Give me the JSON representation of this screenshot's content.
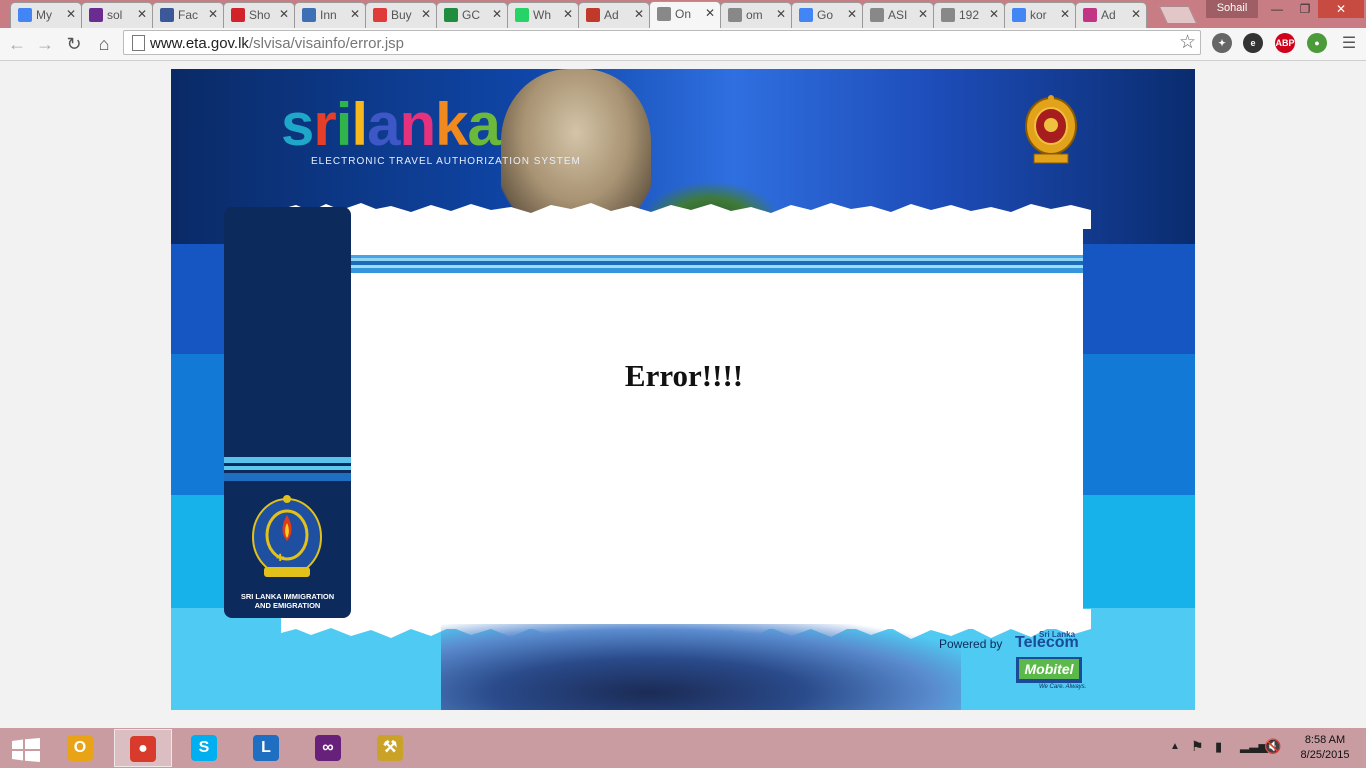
{
  "browser": {
    "tabs": [
      {
        "label": "My",
        "icon": "google-drive-icon",
        "color": "#4285f4"
      },
      {
        "label": "sol",
        "icon": "mail-icon",
        "color": "#6b2c91"
      },
      {
        "label": "Fac",
        "icon": "facebook-icon",
        "color": "#3b5998"
      },
      {
        "label": "Sho",
        "icon": "shopping-icon",
        "color": "#d2232a"
      },
      {
        "label": "Inn",
        "icon": "chat-icon",
        "color": "#3f6fb5"
      },
      {
        "label": "Buy",
        "icon": "cart-icon",
        "color": "#e03b3b"
      },
      {
        "label": "GC",
        "icon": "sheets-icon",
        "color": "#1e8e3e"
      },
      {
        "label": "Wh",
        "icon": "whatsapp-icon",
        "color": "#25d366"
      },
      {
        "label": "Ad",
        "icon": "ad-icon",
        "color": "#c0392b"
      },
      {
        "label": "On",
        "icon": "page-icon",
        "color": "#888888"
      },
      {
        "label": "om",
        "icon": "page-icon",
        "color": "#888888"
      },
      {
        "label": "Go",
        "icon": "translate-icon",
        "color": "#4285f4"
      },
      {
        "label": "ASI",
        "icon": "page-icon",
        "color": "#888888"
      },
      {
        "label": "192",
        "icon": "page-icon",
        "color": "#888888"
      },
      {
        "label": "kor",
        "icon": "google-icon",
        "color": "#4285f4"
      },
      {
        "label": "Ad",
        "icon": "instagram-icon",
        "color": "#c13584"
      }
    ],
    "active_tab": 9,
    "profile_name": "Sohail",
    "url_host": "www.eta.gov.lk",
    "url_path": "/slvisa/visainfo/error.jsp",
    "extensions": [
      "puzzle-icon",
      "e-icon",
      "ABP",
      "globe-icon"
    ]
  },
  "page": {
    "logo_word": "srilanka",
    "logo_sub": "ELECTRONIC TRAVEL AUTHORIZATION SYSTEM",
    "error_title": "Error!!!!",
    "immigration_line1": "SRI LANKA IMMIGRATION",
    "immigration_line2": "AND EMIGRATION",
    "powered_by": "Powered by",
    "telecom": "Telecom",
    "telecom_small": "Sri Lanka",
    "mobitel": "Mobitel",
    "tagline": "We Care. Always."
  },
  "taskbar": {
    "apps": [
      "outlook-icon",
      "chrome-icon",
      "skype-icon",
      "lync-icon",
      "visual-studio-icon",
      "tools-icon"
    ],
    "active_app": 1,
    "time": "8:58 AM",
    "date": "8/25/2015"
  },
  "colors": {
    "tab_strip": "#c77d83",
    "taskbar": "#c89ca1",
    "page_navy": "#0f3677",
    "sky_blue": "#0f46a8",
    "band_mid": "#1279d6",
    "band_light": "#2bb8ee",
    "band_bottom": "#4fcaf2"
  }
}
